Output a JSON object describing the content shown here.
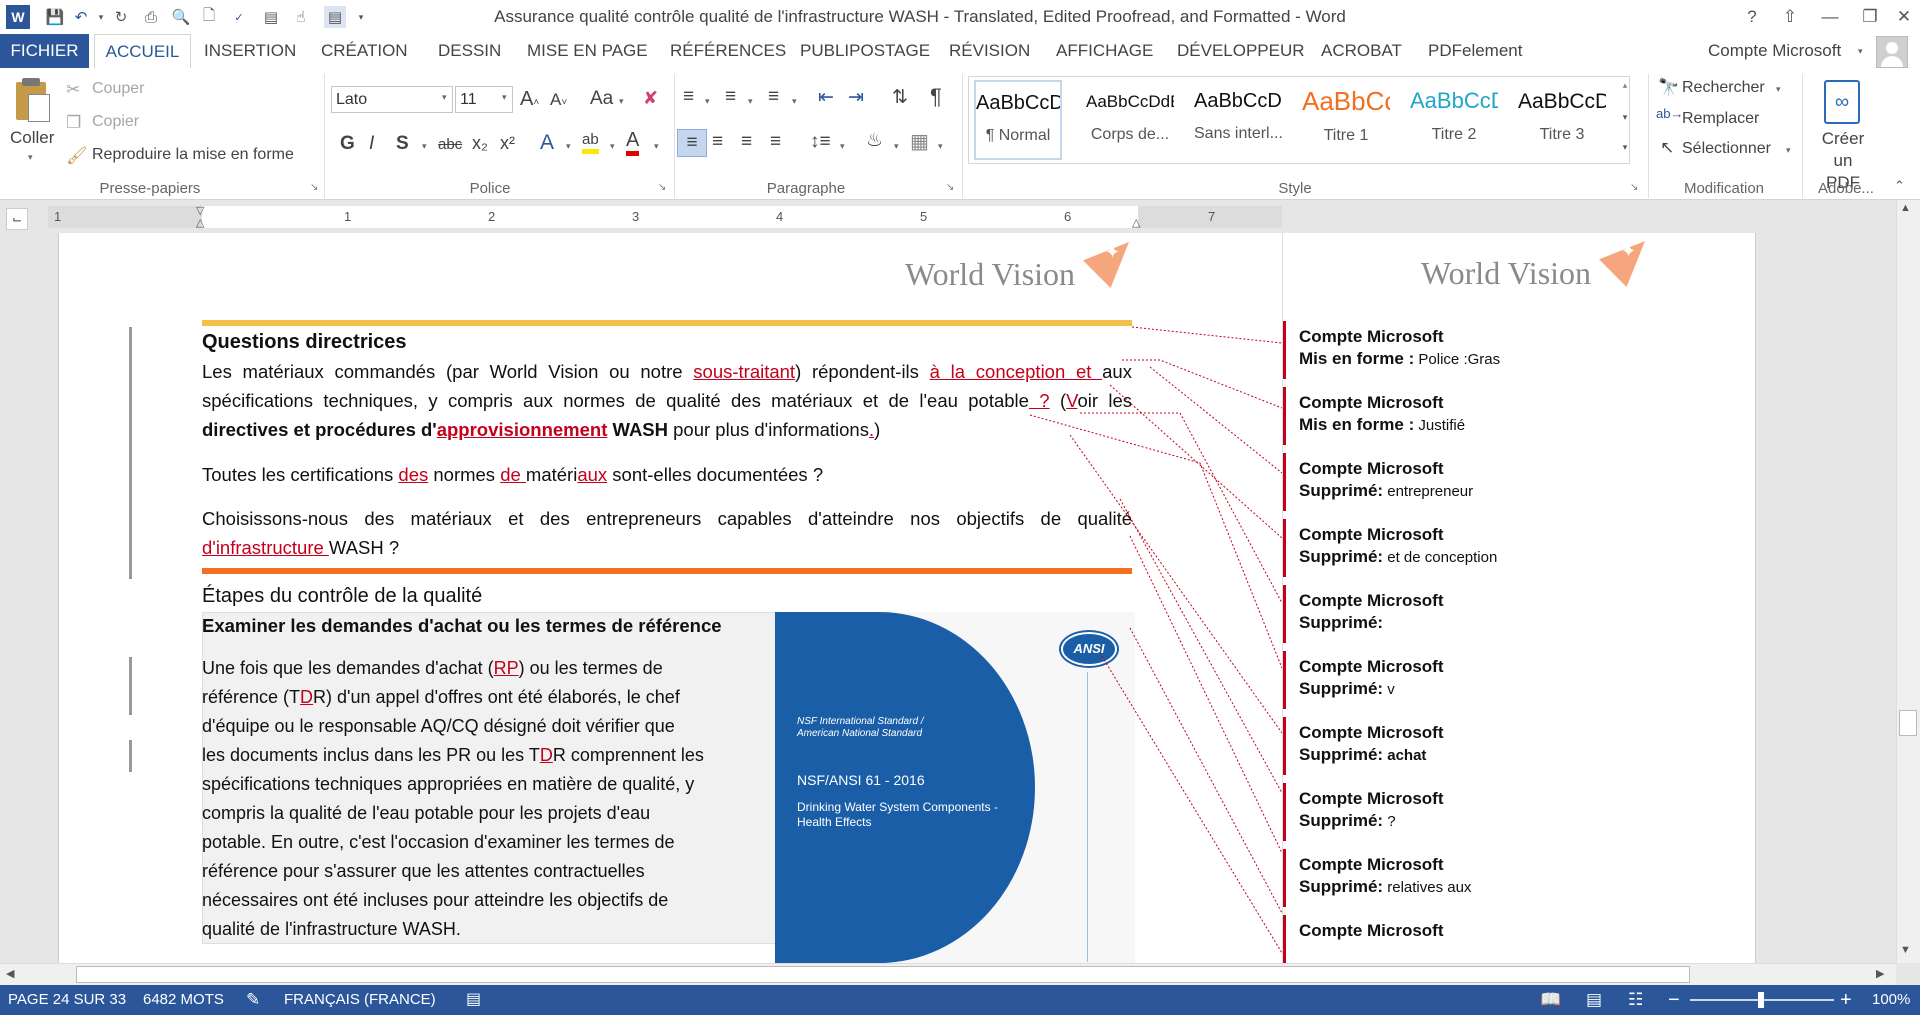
{
  "app": {
    "title": "Assurance qualité  contrôle qualité de l'infrastructure WASH - Translated, Edited Proofread, and Formatted - Word",
    "account": "Compte Microsoft",
    "help": "?",
    "colors": {
      "brand": "#2b579a",
      "revision": "#c4001b",
      "accent_gold": "#f5c04a",
      "accent_orange": "#f26f21"
    }
  },
  "tabs": [
    {
      "label": "FICHIER"
    },
    {
      "label": "ACCUEIL"
    },
    {
      "label": "INSERTION"
    },
    {
      "label": "CRÉATION"
    },
    {
      "label": "DESSIN"
    },
    {
      "label": "MISE EN PAGE"
    },
    {
      "label": "RÉFÉRENCES"
    },
    {
      "label": "PUBLIPOSTAGE"
    },
    {
      "label": "RÉVISION"
    },
    {
      "label": "AFFICHAGE"
    },
    {
      "label": "DÉVELOPPEUR"
    },
    {
      "label": "ACROBAT"
    },
    {
      "label": "PDFelement"
    }
  ],
  "clipboard": {
    "paste": "Coller",
    "cut": "Couper",
    "copy": "Copier",
    "format_painter": "Reproduire la mise en forme",
    "group": "Presse-papiers"
  },
  "font": {
    "family": "Lato",
    "size": "11",
    "case": "Aa",
    "group": "Police",
    "bold": "G",
    "italic": "I",
    "underline": "S",
    "strike": "abc",
    "sub": "x₂",
    "sup": "x²"
  },
  "paragraph": {
    "group": "Paragraphe",
    "pilcrow": "¶"
  },
  "styles": {
    "group": "Style",
    "items": [
      {
        "preview": "AaBbCcDc",
        "name": "¶ Normal",
        "color": "#111111"
      },
      {
        "preview": "AaBbCcDdE",
        "name": "Corps de...",
        "color": "#111111"
      },
      {
        "preview": "AaBbCcDc",
        "name": "Sans interl...",
        "color": "#111111"
      },
      {
        "preview": "AaBbCc",
        "name": "Titre 1",
        "color": "#f26f21"
      },
      {
        "preview": "AaBbCcD",
        "name": "Titre 2",
        "color": "#1ea7c7"
      },
      {
        "preview": "AaBbCcD",
        "name": "Titre 3",
        "color": "#111111"
      }
    ]
  },
  "editing": {
    "find": "Rechercher",
    "replace": "Remplacer",
    "select": "Sélectionner",
    "group": "Modification"
  },
  "adobe": {
    "create_pdf": "Créer un PDF",
    "group": "Adobe..."
  },
  "ruler": {
    "marks": [
      "1",
      "1",
      "2",
      "3",
      "4",
      "5",
      "6",
      "7"
    ]
  },
  "document": {
    "logo": "World Vision",
    "heading1": "Questions directrices",
    "p1": [
      [
        {
          "t": "Les matériaux commandés (par World Vision ou notre "
        },
        {
          "t": "sous-traitant",
          "ins": true
        },
        {
          "t": ") répondent-ils "
        },
        {
          "t": "à la conception et ",
          "ins": true
        },
        {
          "t": "aux"
        }
      ],
      [
        {
          "t": "spécifications techniques, y compris aux normes de qualité des matériaux et de l'eau potable"
        },
        {
          "t": " ?",
          "ins": true
        },
        {
          "t": " ("
        },
        {
          "t": "V",
          "ins": true
        },
        {
          "t": "oir les"
        }
      ],
      [
        {
          "t": "directives et procédures d'",
          "b": true
        },
        {
          "t": "approvisionnement",
          "ins": true,
          "b": true
        },
        {
          "t": " WASH",
          "b": true
        },
        {
          "t": " pour plus d'informations"
        },
        {
          "t": ".",
          "ins": true
        },
        {
          "t": ")"
        }
      ]
    ],
    "p2": [
      {
        "t": "Toutes les certifications "
      },
      {
        "t": "des",
        "ins": true
      },
      {
        "t": " normes "
      },
      {
        "t": "de ",
        "ins": true
      },
      {
        "t": "matéri"
      },
      {
        "t": "aux",
        "ins": true
      },
      {
        "t": " sont-elles documentées ?"
      }
    ],
    "p3": [
      [
        {
          "t": "Choisissons-nous des matériaux et des entrepreneurs capables d'atteindre nos objectifs de qualité"
        }
      ],
      [
        {
          "t": "d'infrastructure ",
          "ins": true
        },
        {
          "t": "WASH"
        },
        {
          "t": " ?"
        }
      ]
    ],
    "heading2": "Étapes du contrôle de la qualité",
    "heading3": "Examiner les demandes d'achat ou les termes de référence",
    "p4": [
      [
        {
          "t": "Une fois que les demandes d'achat ("
        },
        {
          "t": "RP",
          "ins": true
        },
        {
          "t": ") ou les termes de"
        }
      ],
      [
        {
          "t": "référence (T"
        },
        {
          "t": "D",
          "ins": true
        },
        {
          "t": "R) d'un appel d'offres ont été élaborés, le chef"
        }
      ],
      [
        {
          "t": "d'équipe ou le responsable AQ/CQ désigné doit vérifier que"
        }
      ],
      [
        {
          "t": "les documents inclus dans les PR ou les T"
        },
        {
          "t": "D",
          "ins": true
        },
        {
          "t": "R comprennent les"
        }
      ],
      [
        {
          "t": "spécifications techniques appropriées en matière de qualité, y"
        }
      ],
      [
        {
          "t": "compris la qualité de l'eau potable pour les projets d'eau"
        }
      ],
      [
        {
          "t": "potable. En outre, c'est l'occasion d'examiner les termes de"
        }
      ],
      [
        {
          "t": "référence pour s'assurer que les attentes contractuelles"
        }
      ],
      [
        {
          "t": "nécessaires ont été incluses pour atteindre les objectifs de"
        }
      ],
      [
        {
          "t": "qualité de l'infrastructure WASH."
        }
      ]
    ],
    "image": {
      "badge": "ANSI",
      "std_line1": "NSF International Standard /",
      "std_line2": "American National Standard",
      "code": "NSF/ANSI 61 - 2016",
      "desc1": "Drinking Water System Components -",
      "desc2": "Health Effects"
    }
  },
  "comments": [
    {
      "author": "Compte Microsoft",
      "action": "Mis en forme :",
      "detail": " Police :Gras"
    },
    {
      "author": "Compte Microsoft",
      "action": "Mis en forme :",
      "detail": " Justifié"
    },
    {
      "author": "Compte Microsoft",
      "action": "Supprimé:",
      "detail": " entrepreneur"
    },
    {
      "author": "Compte Microsoft",
      "action": "Supprimé:",
      "detail": "  et de conception"
    },
    {
      "author": "Compte Microsoft",
      "action": "Supprimé:",
      "detail": ""
    },
    {
      "author": "Compte Microsoft",
      "action": "Supprimé:",
      "detail": " v"
    },
    {
      "author": "Compte Microsoft",
      "action": "Supprimé:",
      "detail": " achat",
      "bold": true
    },
    {
      "author": "Compte Microsoft",
      "action": "Supprimé:",
      "detail": "  ?"
    },
    {
      "author": "Compte Microsoft",
      "action": "Supprimé:",
      "detail": " relatives aux"
    },
    {
      "author": "Compte Microsoft",
      "action": "",
      "detail": ""
    }
  ],
  "status": {
    "page": "PAGE 24 SUR 33",
    "words": "6482 MOTS",
    "language": "FRANÇAIS (FRANCE)",
    "zoom": "100%"
  }
}
